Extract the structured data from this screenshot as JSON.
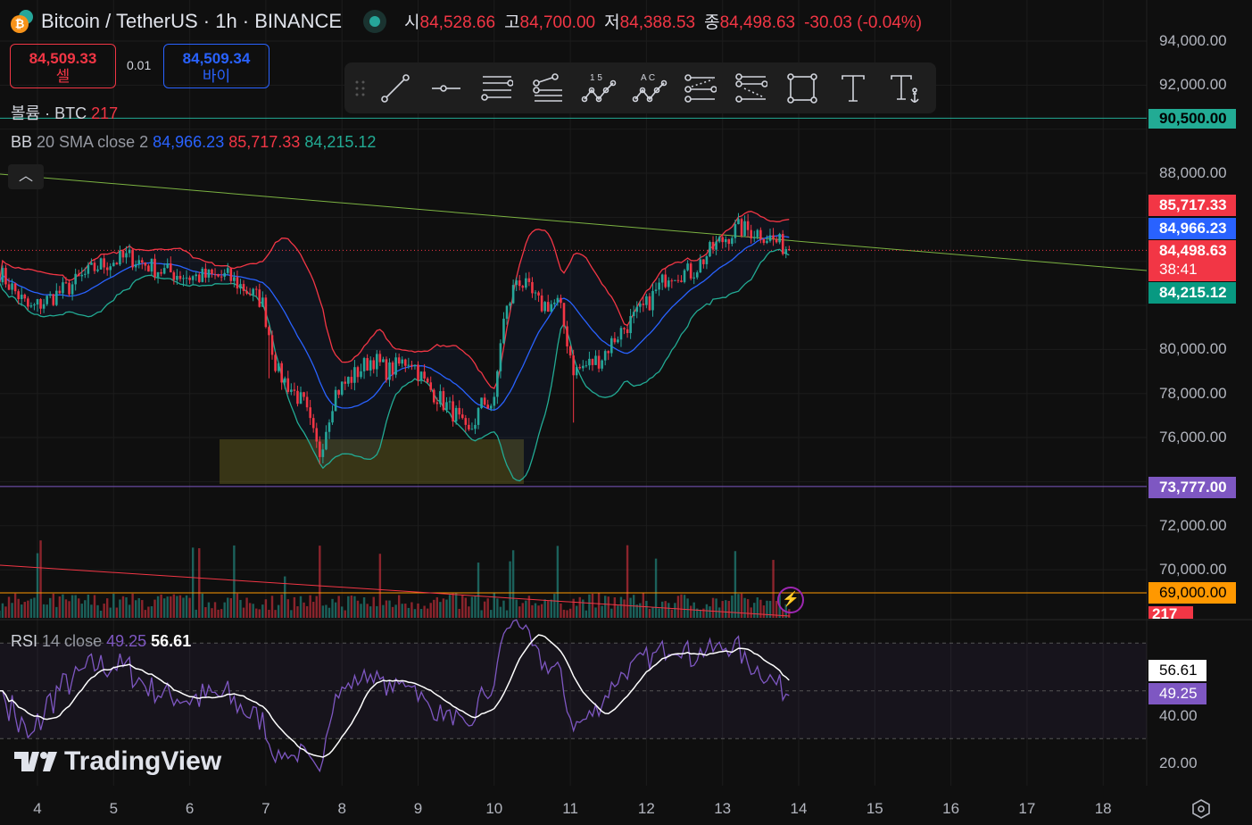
{
  "header": {
    "symbol": "Bitcoin / TetherUS · 1h · BINANCE",
    "o_label": "시",
    "o": "84,528.66",
    "h_label": "고",
    "h": "84,700.00",
    "l_label": "저",
    "l": "84,388.53",
    "c_label": "종",
    "c": "84,498.63",
    "change": "-30.03 (-0.04%)"
  },
  "trade": {
    "sell_price": "84,509.33",
    "sell_label": "셀",
    "spread": "0.01",
    "buy_price": "84,509.34",
    "buy_label": "바이"
  },
  "toolbar": {
    "tools": [
      "trend-line",
      "horizontal-ray",
      "parallel-channel",
      "pitchfork",
      "xabcd-1-5",
      "abcd",
      "fib-retracement",
      "fib-extension",
      "rectangle",
      "text",
      "anchored-text"
    ],
    "label_15": "1  5",
    "label_ac": "A  C"
  },
  "volume_legend": {
    "label": "볼륨 · BTC",
    "value": "217"
  },
  "bb_legend": {
    "label": "BB",
    "params": "20 SMA close 2",
    "basis": "84,966.23",
    "upper": "85,717.33",
    "lower": "84,215.12"
  },
  "rsi_legend": {
    "label": "RSI",
    "params": "14 close",
    "rsi": "49.25",
    "ma": "56.61"
  },
  "price_axis": [
    "94,000.00",
    "92,000.00",
    "88,000.00",
    "80,000.00",
    "78,000.00",
    "76,000.00",
    "72,000.00",
    "70,000.00"
  ],
  "price_tags": {
    "line_90500": "90,500.00",
    "upper": "85,717.33",
    "basis": "84,966.23",
    "last": "84,498.63",
    "countdown": "38:41",
    "lower": "84,215.12",
    "line_73777": "73,777.00",
    "line_69000": "69,000.00",
    "volume": "217"
  },
  "rsi_axis": [
    "40.00",
    "20.00"
  ],
  "rsi_tags": {
    "ma": "56.61",
    "rsi": "49.25"
  },
  "time_axis": [
    "4",
    "5",
    "6",
    "7",
    "8",
    "9",
    "10",
    "11",
    "12",
    "13",
    "14",
    "15",
    "16",
    "17",
    "18"
  ],
  "brand": "TradingView",
  "colors": {
    "up": "#26a69a",
    "down": "#f23645",
    "basis": "#2962ff",
    "rsi": "#7e57c2",
    "teal_line": "#22ab94",
    "purple_line": "#7e57c2",
    "orange_line": "#ff9800"
  },
  "chart_data": {
    "type": "candlestick",
    "interval": "1h",
    "path": [
      [
        3.5,
        83500
      ],
      [
        3.9,
        81800
      ],
      [
        4.4,
        82800
      ],
      [
        4.8,
        83800
      ],
      [
        5.2,
        84200
      ],
      [
        5.6,
        83600
      ],
      [
        6.0,
        83300
      ],
      [
        6.5,
        83300
      ],
      [
        6.95,
        82200
      ],
      [
        7.15,
        79000
      ],
      [
        7.5,
        77500
      ],
      [
        7.7,
        75200
      ],
      [
        7.9,
        78000
      ],
      [
        8.4,
        79600
      ],
      [
        8.6,
        79000
      ],
      [
        8.9,
        79600
      ],
      [
        9.1,
        78400
      ],
      [
        9.5,
        77000
      ],
      [
        9.65,
        76000
      ],
      [
        9.85,
        77600
      ],
      [
        10.0,
        77500
      ],
      [
        10.1,
        81000
      ],
      [
        10.3,
        83300
      ],
      [
        10.6,
        82000
      ],
      [
        10.85,
        82100
      ],
      [
        11.05,
        79000
      ],
      [
        11.4,
        79600
      ],
      [
        11.6,
        80600
      ],
      [
        12.0,
        82000
      ],
      [
        12.3,
        83500
      ],
      [
        12.6,
        83500
      ],
      [
        12.9,
        84700
      ],
      [
        13.2,
        85500
      ],
      [
        13.5,
        85300
      ],
      [
        13.9,
        84500
      ]
    ],
    "horizontal_lines": [
      90500,
      73777,
      69000
    ],
    "last_price": 84498.63
  }
}
